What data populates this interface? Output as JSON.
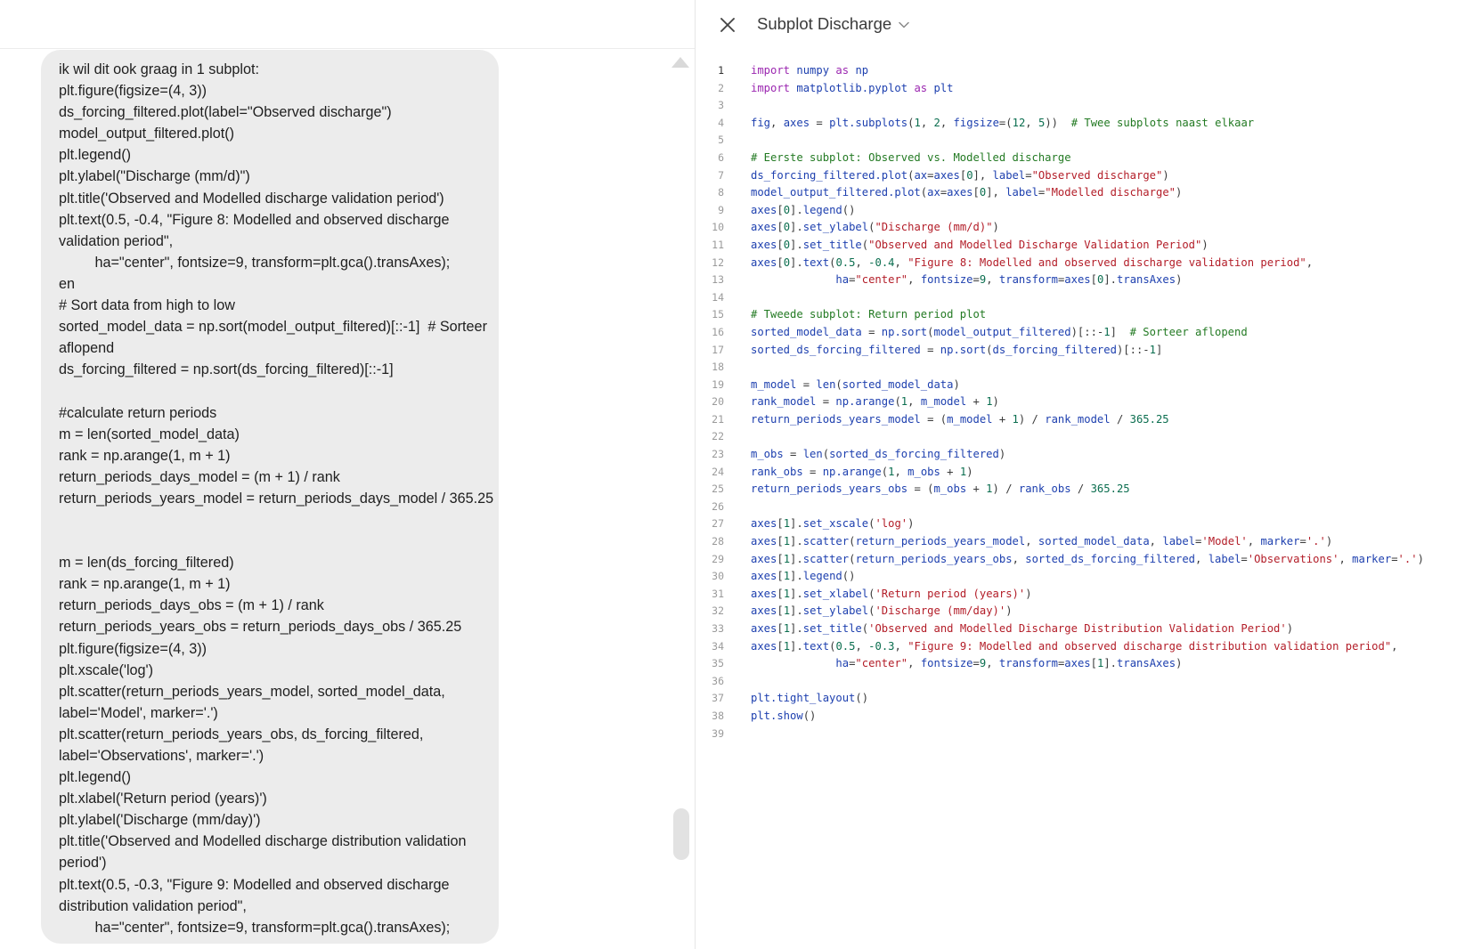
{
  "chat": {
    "user_message_lines": [
      "ik wil dit ook graag in 1 subplot:",
      "plt.figure(figsize=(4, 3))",
      "ds_forcing_filtered.plot(label=\"Observed discharge\")",
      "model_output_filtered.plot()",
      "plt.legend()",
      "plt.ylabel(\"Discharge (mm/d)\")",
      "plt.title('Observed and Modelled discharge validation period')",
      "plt.text(0.5, -0.4, \"Figure 8: Modelled and observed discharge",
      "validation period\",",
      "         ha=\"center\", fontsize=9, transform=plt.gca().transAxes);",
      "en",
      "# Sort data from high to low",
      "sorted_model_data = np.sort(model_output_filtered)[::-1]  # Sorteer",
      "aflopend",
      "ds_forcing_filtered = np.sort(ds_forcing_filtered)[::-1]",
      "",
      "#calculate return periods",
      "m = len(sorted_model_data)",
      "rank = np.arange(1, m + 1)",
      "return_periods_days_model = (m + 1) / rank",
      "return_periods_years_model = return_periods_days_model / 365.25",
      "",
      "",
      "m = len(ds_forcing_filtered)",
      "rank = np.arange(1, m + 1)",
      "return_periods_days_obs = (m + 1) / rank",
      "return_periods_years_obs = return_periods_days_obs / 365.25",
      "plt.figure(figsize=(4, 3))",
      "plt.xscale('log')",
      "plt.scatter(return_periods_years_model, sorted_model_data,",
      "label='Model', marker='.')",
      "plt.scatter(return_periods_years_obs, ds_forcing_filtered,",
      "label='Observations', marker='.')",
      "plt.legend()",
      "plt.xlabel('Return period (years)')",
      "plt.ylabel('Discharge (mm/day)')",
      "plt.title('Observed and Modelled discharge distribution validation",
      "period')",
      "plt.text(0.5, -0.3, \"Figure 9: Modelled and observed discharge",
      "distribution validation period\",",
      "         ha=\"center\", fontsize=9, transform=plt.gca().transAxes);"
    ]
  },
  "canvas": {
    "title": "Subplot Discharge",
    "icons": {
      "close": "close-icon",
      "title_dropdown": "chevron-down-icon"
    },
    "colors": {
      "keyword": "#9b27b0",
      "function": "#1e40af",
      "number": "#0b6e4f",
      "string": "#b31d28",
      "comment": "#237a23",
      "plain": "#3b3b3b"
    },
    "active_line": 1,
    "code_lines": [
      [
        [
          "kw",
          "import"
        ],
        [
          "pl",
          " "
        ],
        [
          "fn",
          "numpy"
        ],
        [
          "pl",
          " "
        ],
        [
          "kw",
          "as"
        ],
        [
          "pl",
          " "
        ],
        [
          "fn",
          "np"
        ]
      ],
      [
        [
          "kw",
          "import"
        ],
        [
          "pl",
          " "
        ],
        [
          "fn",
          "matplotlib.pyplot"
        ],
        [
          "pl",
          " "
        ],
        [
          "kw",
          "as"
        ],
        [
          "pl",
          " "
        ],
        [
          "fn",
          "plt"
        ]
      ],
      [],
      [
        [
          "fn",
          "fig"
        ],
        [
          "pl",
          ", "
        ],
        [
          "fn",
          "axes"
        ],
        [
          "pl",
          " = "
        ],
        [
          "fn",
          "plt.subplots"
        ],
        [
          "pl",
          "("
        ],
        [
          "num",
          "1"
        ],
        [
          "pl",
          ", "
        ],
        [
          "num",
          "2"
        ],
        [
          "pl",
          ", "
        ],
        [
          "fn",
          "figsize"
        ],
        [
          "pl",
          "=("
        ],
        [
          "num",
          "12"
        ],
        [
          "pl",
          ", "
        ],
        [
          "num",
          "5"
        ],
        [
          "pl",
          "))  "
        ],
        [
          "cm",
          "# Twee subplots naast elkaar"
        ]
      ],
      [],
      [
        [
          "cm",
          "# Eerste subplot: Observed vs. Modelled discharge"
        ]
      ],
      [
        [
          "fn",
          "ds_forcing_filtered.plot"
        ],
        [
          "pl",
          "("
        ],
        [
          "fn",
          "ax"
        ],
        [
          "pl",
          "="
        ],
        [
          "fn",
          "axes"
        ],
        [
          "pl",
          "["
        ],
        [
          "num",
          "0"
        ],
        [
          "pl",
          "], "
        ],
        [
          "fn",
          "label"
        ],
        [
          "pl",
          "="
        ],
        [
          "str",
          "\"Observed discharge\""
        ],
        [
          "pl",
          ")"
        ]
      ],
      [
        [
          "fn",
          "model_output_filtered.plot"
        ],
        [
          "pl",
          "("
        ],
        [
          "fn",
          "ax"
        ],
        [
          "pl",
          "="
        ],
        [
          "fn",
          "axes"
        ],
        [
          "pl",
          "["
        ],
        [
          "num",
          "0"
        ],
        [
          "pl",
          "], "
        ],
        [
          "fn",
          "label"
        ],
        [
          "pl",
          "="
        ],
        [
          "str",
          "\"Modelled discharge\""
        ],
        [
          "pl",
          ")"
        ]
      ],
      [
        [
          "fn",
          "axes"
        ],
        [
          "pl",
          "["
        ],
        [
          "num",
          "0"
        ],
        [
          "pl",
          "]."
        ],
        [
          "fn",
          "legend"
        ],
        [
          "pl",
          "()"
        ]
      ],
      [
        [
          "fn",
          "axes"
        ],
        [
          "pl",
          "["
        ],
        [
          "num",
          "0"
        ],
        [
          "pl",
          "]."
        ],
        [
          "fn",
          "set_ylabel"
        ],
        [
          "pl",
          "("
        ],
        [
          "str",
          "\"Discharge (mm/d)\""
        ],
        [
          "pl",
          ")"
        ]
      ],
      [
        [
          "fn",
          "axes"
        ],
        [
          "pl",
          "["
        ],
        [
          "num",
          "0"
        ],
        [
          "pl",
          "]."
        ],
        [
          "fn",
          "set_title"
        ],
        [
          "pl",
          "("
        ],
        [
          "str",
          "\"Observed and Modelled Discharge Validation Period\""
        ],
        [
          "pl",
          ")"
        ]
      ],
      [
        [
          "fn",
          "axes"
        ],
        [
          "pl",
          "["
        ],
        [
          "num",
          "0"
        ],
        [
          "pl",
          "]."
        ],
        [
          "fn",
          "text"
        ],
        [
          "pl",
          "("
        ],
        [
          "num",
          "0.5"
        ],
        [
          "pl",
          ", "
        ],
        [
          "num",
          "-0.4"
        ],
        [
          "pl",
          ", "
        ],
        [
          "str",
          "\"Figure 8: Modelled and observed discharge validation period\""
        ],
        [
          "pl",
          ","
        ]
      ],
      [
        [
          "pl",
          "             "
        ],
        [
          "fn",
          "ha"
        ],
        [
          "pl",
          "="
        ],
        [
          "str",
          "\"center\""
        ],
        [
          "pl",
          ", "
        ],
        [
          "fn",
          "fontsize"
        ],
        [
          "pl",
          "="
        ],
        [
          "num",
          "9"
        ],
        [
          "pl",
          ", "
        ],
        [
          "fn",
          "transform"
        ],
        [
          "pl",
          "="
        ],
        [
          "fn",
          "axes"
        ],
        [
          "pl",
          "["
        ],
        [
          "num",
          "0"
        ],
        [
          "pl",
          "]."
        ],
        [
          "fn",
          "transAxes"
        ],
        [
          "pl",
          ")"
        ]
      ],
      [],
      [
        [
          "cm",
          "# Tweede subplot: Return period plot"
        ]
      ],
      [
        [
          "fn",
          "sorted_model_data"
        ],
        [
          "pl",
          " = "
        ],
        [
          "fn",
          "np.sort"
        ],
        [
          "pl",
          "("
        ],
        [
          "fn",
          "model_output_filtered"
        ],
        [
          "pl",
          ")[::-"
        ],
        [
          "num",
          "1"
        ],
        [
          "pl",
          "]  "
        ],
        [
          "cm",
          "# Sorteer aflopend"
        ]
      ],
      [
        [
          "fn",
          "sorted_ds_forcing_filtered"
        ],
        [
          "pl",
          " = "
        ],
        [
          "fn",
          "np.sort"
        ],
        [
          "pl",
          "("
        ],
        [
          "fn",
          "ds_forcing_filtered"
        ],
        [
          "pl",
          ")[::-"
        ],
        [
          "num",
          "1"
        ],
        [
          "pl",
          "]"
        ]
      ],
      [],
      [
        [
          "fn",
          "m_model"
        ],
        [
          "pl",
          " = "
        ],
        [
          "fn",
          "len"
        ],
        [
          "pl",
          "("
        ],
        [
          "fn",
          "sorted_model_data"
        ],
        [
          "pl",
          ")"
        ]
      ],
      [
        [
          "fn",
          "rank_model"
        ],
        [
          "pl",
          " = "
        ],
        [
          "fn",
          "np.arange"
        ],
        [
          "pl",
          "("
        ],
        [
          "num",
          "1"
        ],
        [
          "pl",
          ", "
        ],
        [
          "fn",
          "m_model"
        ],
        [
          "pl",
          " + "
        ],
        [
          "num",
          "1"
        ],
        [
          "pl",
          ")"
        ]
      ],
      [
        [
          "fn",
          "return_periods_years_model"
        ],
        [
          "pl",
          " = ("
        ],
        [
          "fn",
          "m_model"
        ],
        [
          "pl",
          " + "
        ],
        [
          "num",
          "1"
        ],
        [
          "pl",
          ") / "
        ],
        [
          "fn",
          "rank_model"
        ],
        [
          "pl",
          " / "
        ],
        [
          "num",
          "365.25"
        ]
      ],
      [],
      [
        [
          "fn",
          "m_obs"
        ],
        [
          "pl",
          " = "
        ],
        [
          "fn",
          "len"
        ],
        [
          "pl",
          "("
        ],
        [
          "fn",
          "sorted_ds_forcing_filtered"
        ],
        [
          "pl",
          ")"
        ]
      ],
      [
        [
          "fn",
          "rank_obs"
        ],
        [
          "pl",
          " = "
        ],
        [
          "fn",
          "np.arange"
        ],
        [
          "pl",
          "("
        ],
        [
          "num",
          "1"
        ],
        [
          "pl",
          ", "
        ],
        [
          "fn",
          "m_obs"
        ],
        [
          "pl",
          " + "
        ],
        [
          "num",
          "1"
        ],
        [
          "pl",
          ")"
        ]
      ],
      [
        [
          "fn",
          "return_periods_years_obs"
        ],
        [
          "pl",
          " = ("
        ],
        [
          "fn",
          "m_obs"
        ],
        [
          "pl",
          " + "
        ],
        [
          "num",
          "1"
        ],
        [
          "pl",
          ") / "
        ],
        [
          "fn",
          "rank_obs"
        ],
        [
          "pl",
          " / "
        ],
        [
          "num",
          "365.25"
        ]
      ],
      [],
      [
        [
          "fn",
          "axes"
        ],
        [
          "pl",
          "["
        ],
        [
          "num",
          "1"
        ],
        [
          "pl",
          "]."
        ],
        [
          "fn",
          "set_xscale"
        ],
        [
          "pl",
          "("
        ],
        [
          "str",
          "'log'"
        ],
        [
          "pl",
          ")"
        ]
      ],
      [
        [
          "fn",
          "axes"
        ],
        [
          "pl",
          "["
        ],
        [
          "num",
          "1"
        ],
        [
          "pl",
          "]."
        ],
        [
          "fn",
          "scatter"
        ],
        [
          "pl",
          "("
        ],
        [
          "fn",
          "return_periods_years_model"
        ],
        [
          "pl",
          ", "
        ],
        [
          "fn",
          "sorted_model_data"
        ],
        [
          "pl",
          ", "
        ],
        [
          "fn",
          "label"
        ],
        [
          "pl",
          "="
        ],
        [
          "str",
          "'Model'"
        ],
        [
          "pl",
          ", "
        ],
        [
          "fn",
          "marker"
        ],
        [
          "pl",
          "="
        ],
        [
          "str",
          "'.'"
        ],
        [
          "pl",
          ")"
        ]
      ],
      [
        [
          "fn",
          "axes"
        ],
        [
          "pl",
          "["
        ],
        [
          "num",
          "1"
        ],
        [
          "pl",
          "]."
        ],
        [
          "fn",
          "scatter"
        ],
        [
          "pl",
          "("
        ],
        [
          "fn",
          "return_periods_years_obs"
        ],
        [
          "pl",
          ", "
        ],
        [
          "fn",
          "sorted_ds_forcing_filtered"
        ],
        [
          "pl",
          ", "
        ],
        [
          "fn",
          "label"
        ],
        [
          "pl",
          "="
        ],
        [
          "str",
          "'Observations'"
        ],
        [
          "pl",
          ", "
        ],
        [
          "fn",
          "marker"
        ],
        [
          "pl",
          "="
        ],
        [
          "str",
          "'.'"
        ],
        [
          "pl",
          ")"
        ]
      ],
      [
        [
          "fn",
          "axes"
        ],
        [
          "pl",
          "["
        ],
        [
          "num",
          "1"
        ],
        [
          "pl",
          "]."
        ],
        [
          "fn",
          "legend"
        ],
        [
          "pl",
          "()"
        ]
      ],
      [
        [
          "fn",
          "axes"
        ],
        [
          "pl",
          "["
        ],
        [
          "num",
          "1"
        ],
        [
          "pl",
          "]."
        ],
        [
          "fn",
          "set_xlabel"
        ],
        [
          "pl",
          "("
        ],
        [
          "str",
          "'Return period (years)'"
        ],
        [
          "pl",
          ")"
        ]
      ],
      [
        [
          "fn",
          "axes"
        ],
        [
          "pl",
          "["
        ],
        [
          "num",
          "1"
        ],
        [
          "pl",
          "]."
        ],
        [
          "fn",
          "set_ylabel"
        ],
        [
          "pl",
          "("
        ],
        [
          "str",
          "'Discharge (mm/day)'"
        ],
        [
          "pl",
          ")"
        ]
      ],
      [
        [
          "fn",
          "axes"
        ],
        [
          "pl",
          "["
        ],
        [
          "num",
          "1"
        ],
        [
          "pl",
          "]."
        ],
        [
          "fn",
          "set_title"
        ],
        [
          "pl",
          "("
        ],
        [
          "str",
          "'Observed and Modelled Discharge Distribution Validation Period'"
        ],
        [
          "pl",
          ")"
        ]
      ],
      [
        [
          "fn",
          "axes"
        ],
        [
          "pl",
          "["
        ],
        [
          "num",
          "1"
        ],
        [
          "pl",
          "]."
        ],
        [
          "fn",
          "text"
        ],
        [
          "pl",
          "("
        ],
        [
          "num",
          "0.5"
        ],
        [
          "pl",
          ", "
        ],
        [
          "num",
          "-0.3"
        ],
        [
          "pl",
          ", "
        ],
        [
          "str",
          "\"Figure 9: Modelled and observed discharge distribution validation period\""
        ],
        [
          "pl",
          ","
        ]
      ],
      [
        [
          "pl",
          "             "
        ],
        [
          "fn",
          "ha"
        ],
        [
          "pl",
          "="
        ],
        [
          "str",
          "\"center\""
        ],
        [
          "pl",
          ", "
        ],
        [
          "fn",
          "fontsize"
        ],
        [
          "pl",
          "="
        ],
        [
          "num",
          "9"
        ],
        [
          "pl",
          ", "
        ],
        [
          "fn",
          "transform"
        ],
        [
          "pl",
          "="
        ],
        [
          "fn",
          "axes"
        ],
        [
          "pl",
          "["
        ],
        [
          "num",
          "1"
        ],
        [
          "pl",
          "]."
        ],
        [
          "fn",
          "transAxes"
        ],
        [
          "pl",
          ")"
        ]
      ],
      [],
      [
        [
          "fn",
          "plt.tight_layout"
        ],
        [
          "pl",
          "()"
        ]
      ],
      [
        [
          "fn",
          "plt.show"
        ],
        [
          "pl",
          "()"
        ]
      ],
      []
    ]
  }
}
